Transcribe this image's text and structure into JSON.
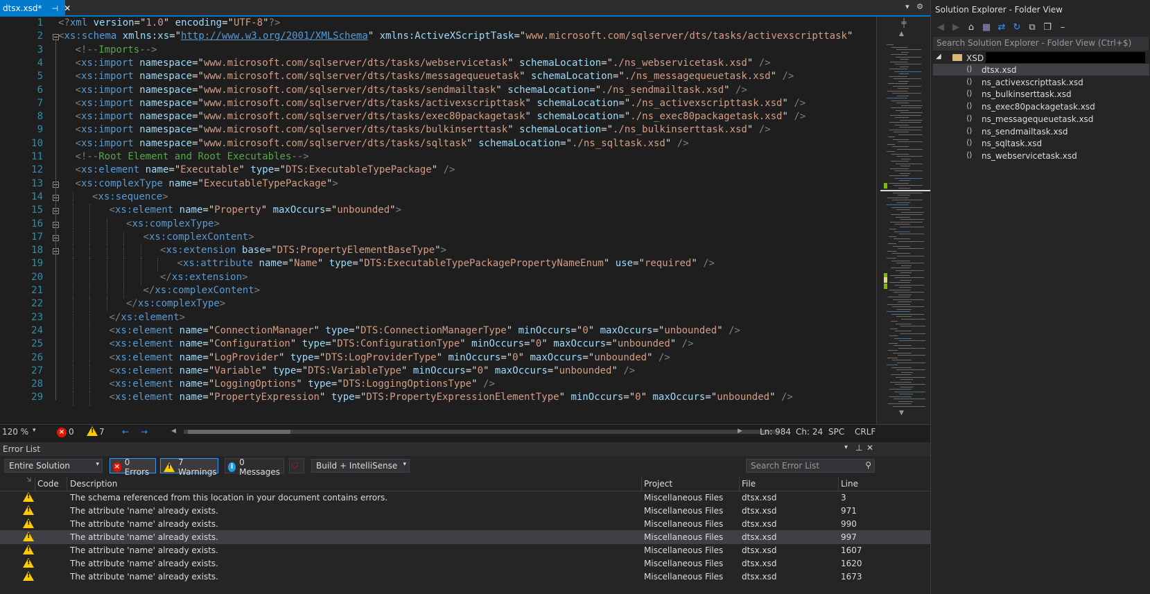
{
  "tab": {
    "title": "dtsx.xsd*",
    "pin": "⊣",
    "close": "✕"
  },
  "tab_tools": {
    "dropdown": "▾",
    "settings": "⚙"
  },
  "editor": {
    "lines": [
      {
        "n": "1",
        "fold": false,
        "indent": 0,
        "html": "<span class='pu'>&lt;?</span><span class='tag'>xml</span> <span class='at'>version</span><span class='tx'>=\"</span><span class='av'>1.0</span><span class='tx'>\"</span> <span class='at'>encoding</span><span class='tx'>=\"</span><span class='av'>UTF-8</span><span class='tx'>\"</span><span class='pu'>?&gt;</span>"
      },
      {
        "n": "2",
        "fold": true,
        "indent": 0,
        "html": "<span class='pu'>&lt;</span><span class='tag'>xs:schema</span> <span class='at'>xmlns:xs</span><span class='tx'>=\"</span><span class='av' style='color:#569cd6;text-decoration:underline'>http://www.w3.org/2001/XMLSchema</span><span class='tx'>\"</span> <span class='at'>xmlns:ActiveXScriptTask</span><span class='tx'>=\"</span><span class='av'>www.microsoft.com/sqlserver/dts/tasks/activexscripttask</span><span class='tx'>\"</span>"
      },
      {
        "n": "3",
        "fold": false,
        "indent": 1,
        "html": "<span class='pu'>&lt;!--</span><span class='cm'>Imports</span><span class='pu'>--&gt;</span>"
      },
      {
        "n": "4",
        "fold": false,
        "indent": 1,
        "html": "<span class='pu'>&lt;</span><span class='tag'>xs:import</span> <span class='at'>namespace</span><span class='tx'>=\"</span><span class='av'>www.microsoft.com/sqlserver/dts/tasks/webservicetask</span><span class='tx'>\"</span> <span class='at'>schemaLocation</span><span class='tx'>=\"</span><span class='av'>./ns_webservicetask.xsd</span><span class='tx'>\"</span> <span class='pu'>/&gt;</span>"
      },
      {
        "n": "5",
        "fold": false,
        "indent": 1,
        "html": "<span class='pu'>&lt;</span><span class='tag'>xs:import</span> <span class='at'>namespace</span><span class='tx'>=\"</span><span class='av'>www.microsoft.com/sqlserver/dts/tasks/messagequeuetask</span><span class='tx'>\"</span> <span class='at'>schemaLocation</span><span class='tx'>=\"</span><span class='av'>./ns_messagequeuetask.xsd</span><span class='tx'>\"</span> <span class='pu'>/&gt;</span>"
      },
      {
        "n": "6",
        "fold": false,
        "indent": 1,
        "html": "<span class='pu'>&lt;</span><span class='tag'>xs:import</span> <span class='at'>namespace</span><span class='tx'>=\"</span><span class='av'>www.microsoft.com/sqlserver/dts/tasks/sendmailtask</span><span class='tx'>\"</span> <span class='at'>schemaLocation</span><span class='tx'>=\"</span><span class='av'>./ns_sendmailtask.xsd</span><span class='tx'>\"</span> <span class='pu'>/&gt;</span>"
      },
      {
        "n": "7",
        "fold": false,
        "indent": 1,
        "html": "<span class='pu'>&lt;</span><span class='tag'>xs:import</span> <span class='at'>namespace</span><span class='tx'>=\"</span><span class='av'>www.microsoft.com/sqlserver/dts/tasks/activexscripttask</span><span class='tx'>\"</span> <span class='at'>schemaLocation</span><span class='tx'>=\"</span><span class='av'>./ns_activexscripttask.xsd</span><span class='tx'>\"</span> <span class='pu'>/&gt;</span>"
      },
      {
        "n": "8",
        "fold": false,
        "indent": 1,
        "html": "<span class='pu'>&lt;</span><span class='tag'>xs:import</span> <span class='at'>namespace</span><span class='tx'>=\"</span><span class='av'>www.microsoft.com/sqlserver/dts/tasks/exec80packagetask</span><span class='tx'>\"</span> <span class='at'>schemaLocation</span><span class='tx'>=\"</span><span class='av'>./ns_exec80packagetask.xsd</span><span class='tx'>\"</span> <span class='pu'>/&gt;</span>"
      },
      {
        "n": "9",
        "fold": false,
        "indent": 1,
        "html": "<span class='pu'>&lt;</span><span class='tag'>xs:import</span> <span class='at'>namespace</span><span class='tx'>=\"</span><span class='av'>www.microsoft.com/sqlserver/dts/tasks/bulkinserttask</span><span class='tx'>\"</span> <span class='at'>schemaLocation</span><span class='tx'>=\"</span><span class='av'>./ns_bulkinserttask.xsd</span><span class='tx'>\"</span> <span class='pu'>/&gt;</span>"
      },
      {
        "n": "10",
        "fold": false,
        "indent": 1,
        "html": "<span class='pu'>&lt;</span><span class='tag'>xs:import</span> <span class='at'>namespace</span><span class='tx'>=\"</span><span class='av'>www.microsoft.com/sqlserver/dts/tasks/sqltask</span><span class='tx'>\"</span> <span class='at'>schemaLocation</span><span class='tx'>=\"</span><span class='av'>./ns_sqltask.xsd</span><span class='tx'>\"</span> <span class='pu'>/&gt;</span>"
      },
      {
        "n": "11",
        "fold": false,
        "indent": 1,
        "html": "<span class='pu'>&lt;!--</span><span class='cm'>Root Element and Root Executables</span><span class='pu'>--&gt;</span>"
      },
      {
        "n": "12",
        "fold": false,
        "indent": 1,
        "html": "<span class='pu'>&lt;</span><span class='tag'>xs:element</span> <span class='at'>name</span><span class='tx'>=\"</span><span class='av'>Executable</span><span class='tx'>\"</span> <span class='at'>type</span><span class='tx'>=\"</span><span class='av'>DTS:ExecutableTypePackage</span><span class='tx'>\"</span> <span class='pu'>/&gt;</span>"
      },
      {
        "n": "13",
        "fold": true,
        "indent": 1,
        "html": "<span class='pu'>&lt;</span><span class='tag'>xs:complexType</span> <span class='at'>name</span><span class='tx'>=\"</span><span class='av'>ExecutableTypePackage</span><span class='tx'>\"</span><span class='pu'>&gt;</span>"
      },
      {
        "n": "14",
        "fold": true,
        "indent": 2,
        "html": "<span class='pu'>&lt;</span><span class='tag'>xs:sequence</span><span class='pu'>&gt;</span>"
      },
      {
        "n": "15",
        "fold": true,
        "indent": 3,
        "html": "<span class='pu'>&lt;</span><span class='tag'>xs:element</span> <span class='at'>name</span><span class='tx'>=\"</span><span class='av'>Property</span><span class='tx'>\"</span> <span class='at'>maxOccurs</span><span class='tx'>=\"</span><span class='av'>unbounded</span><span class='tx'>\"</span><span class='pu'>&gt;</span>"
      },
      {
        "n": "16",
        "fold": true,
        "indent": 4,
        "html": "<span class='pu'>&lt;</span><span class='tag'>xs:complexType</span><span class='pu'>&gt;</span>"
      },
      {
        "n": "17",
        "fold": true,
        "indent": 5,
        "html": "<span class='pu'>&lt;</span><span class='tag'>xs:complexContent</span><span class='pu'>&gt;</span>"
      },
      {
        "n": "18",
        "fold": true,
        "indent": 6,
        "html": "<span class='pu'>&lt;</span><span class='tag'>xs:extension</span> <span class='at'>base</span><span class='tx'>=\"</span><span class='av'>DTS:PropertyElementBaseType</span><span class='tx'>\"</span><span class='pu'>&gt;</span>"
      },
      {
        "n": "19",
        "fold": false,
        "indent": 7,
        "html": "<span class='pu'>&lt;</span><span class='tag'>xs:attribute</span> <span class='at'>name</span><span class='tx'>=\"</span><span class='av'>Name</span><span class='tx'>\"</span> <span class='at'>type</span><span class='tx'>=\"</span><span class='av'>DTS:ExecutableTypePackagePropertyNameEnum</span><span class='tx'>\"</span> <span class='at'>use</span><span class='tx'>=\"</span><span class='av'>required</span><span class='tx'>\"</span> <span class='pu'>/&gt;</span>"
      },
      {
        "n": "20",
        "fold": false,
        "indent": 6,
        "html": "<span class='pu'>&lt;/</span><span class='tag'>xs:extension</span><span class='pu'>&gt;</span>"
      },
      {
        "n": "21",
        "fold": false,
        "indent": 5,
        "html": "<span class='pu'>&lt;/</span><span class='tag'>xs:complexContent</span><span class='pu'>&gt;</span>"
      },
      {
        "n": "22",
        "fold": false,
        "indent": 4,
        "html": "<span class='pu'>&lt;/</span><span class='tag'>xs:complexType</span><span class='pu'>&gt;</span>"
      },
      {
        "n": "23",
        "fold": false,
        "indent": 3,
        "html": "<span class='pu'>&lt;/</span><span class='tag'>xs:element</span><span class='pu'>&gt;</span>"
      },
      {
        "n": "24",
        "fold": false,
        "indent": 3,
        "html": "<span class='pu'>&lt;</span><span class='tag'>xs:element</span> <span class='at'>name</span><span class='tx'>=\"</span><span class='av'>ConnectionManager</span><span class='tx'>\"</span> <span class='at'>type</span><span class='tx'>=\"</span><span class='av'>DTS:ConnectionManagerType</span><span class='tx'>\"</span> <span class='at'>minOccurs</span><span class='tx'>=\"</span><span class='av'>0</span><span class='tx'>\"</span> <span class='at'>maxOccurs</span><span class='tx'>=\"</span><span class='av'>unbounded</span><span class='tx'>\"</span> <span class='pu'>/&gt;</span>"
      },
      {
        "n": "25",
        "fold": false,
        "indent": 3,
        "html": "<span class='pu'>&lt;</span><span class='tag'>xs:element</span> <span class='at'>name</span><span class='tx'>=\"</span><span class='av'>Configuration</span><span class='tx'>\"</span> <span class='at'>type</span><span class='tx'>=\"</span><span class='av'>DTS:ConfigurationType</span><span class='tx'>\"</span> <span class='at'>minOccurs</span><span class='tx'>=\"</span><span class='av'>0</span><span class='tx'>\"</span> <span class='at'>maxOccurs</span><span class='tx'>=\"</span><span class='av'>unbounded</span><span class='tx'>\"</span> <span class='pu'>/&gt;</span>"
      },
      {
        "n": "26",
        "fold": false,
        "indent": 3,
        "html": "<span class='pu'>&lt;</span><span class='tag'>xs:element</span> <span class='at'>name</span><span class='tx'>=\"</span><span class='av'>LogProvider</span><span class='tx'>\"</span> <span class='at'>type</span><span class='tx'>=\"</span><span class='av'>DTS:LogProviderType</span><span class='tx'>\"</span> <span class='at'>minOccurs</span><span class='tx'>=\"</span><span class='av'>0</span><span class='tx'>\"</span> <span class='at'>maxOccurs</span><span class='tx'>=\"</span><span class='av'>unbounded</span><span class='tx'>\"</span> <span class='pu'>/&gt;</span>"
      },
      {
        "n": "27",
        "fold": false,
        "indent": 3,
        "html": "<span class='pu'>&lt;</span><span class='tag'>xs:element</span> <span class='at'>name</span><span class='tx'>=\"</span><span class='av'>Variable</span><span class='tx'>\"</span> <span class='at'>type</span><span class='tx'>=\"</span><span class='av'>DTS:VariableType</span><span class='tx'>\"</span> <span class='at'>minOccurs</span><span class='tx'>=\"</span><span class='av'>0</span><span class='tx'>\"</span> <span class='at'>maxOccurs</span><span class='tx'>=\"</span><span class='av'>unbounded</span><span class='tx'>\"</span> <span class='pu'>/&gt;</span>"
      },
      {
        "n": "28",
        "fold": false,
        "indent": 3,
        "html": "<span class='pu'>&lt;</span><span class='tag'>xs:element</span> <span class='at'>name</span><span class='tx'>=\"</span><span class='av'>LoggingOptions</span><span class='tx'>\"</span> <span class='at'>type</span><span class='tx'>=\"</span><span class='av'>DTS:LoggingOptionsType</span><span class='tx'>\"</span> <span class='pu'>/&gt;</span>"
      },
      {
        "n": "29",
        "fold": false,
        "indent": 3,
        "html": "<span class='pu'>&lt;</span><span class='tag'>xs:element</span> <span class='at'>name</span><span class='tx'>=\"</span><span class='av'>PropertyExpression</span><span class='tx'>\"</span> <span class='at'>type</span><span class='tx'>=\"</span><span class='av'>DTS:PropertyExpressionElementType</span><span class='tx'>\"</span> <span class='at'>minOccurs</span><span class='tx'>=\"</span><span class='av'>0</span><span class='tx'>\"</span> <span class='at'>maxOccurs</span><span class='tx'>=\"</span><span class='av'>unbounded</span><span class='tx'>\"</span> <span class='pu'>/&gt;</span>"
      }
    ]
  },
  "status": {
    "zoom": "120 %",
    "errors": "0",
    "warnings": "7",
    "ln": "Ln: 984",
    "ch": "Ch: 24",
    "spc": "SPC",
    "crlf": "CRLF"
  },
  "error_list": {
    "title": "Error List",
    "scope": "Entire Solution",
    "errors_btn": "0 Errors",
    "warnings_btn": "7 Warnings",
    "messages_btn": "0 Messages",
    "build_filter": "Build + IntelliSense",
    "search_placeholder": "Search Error List",
    "columns": {
      "code": "Code",
      "description": "Description",
      "project": "Project",
      "file": "File",
      "line": "Line"
    },
    "rows": [
      {
        "description": "The schema referenced from this location in your document contains errors.",
        "project": "Miscellaneous Files",
        "file": "dtsx.xsd",
        "line": "3"
      },
      {
        "description": "The attribute 'name' already exists.",
        "project": "Miscellaneous Files",
        "file": "dtsx.xsd",
        "line": "971"
      },
      {
        "description": "The attribute 'name' already exists.",
        "project": "Miscellaneous Files",
        "file": "dtsx.xsd",
        "line": "990"
      },
      {
        "description": "The attribute 'name' already exists.",
        "project": "Miscellaneous Files",
        "file": "dtsx.xsd",
        "line": "997"
      },
      {
        "description": "The attribute 'name' already exists.",
        "project": "Miscellaneous Files",
        "file": "dtsx.xsd",
        "line": "1607"
      },
      {
        "description": "The attribute 'name' already exists.",
        "project": "Miscellaneous Files",
        "file": "dtsx.xsd",
        "line": "1620"
      },
      {
        "description": "The attribute 'name' already exists.",
        "project": "Miscellaneous Files",
        "file": "dtsx.xsd",
        "line": "1673"
      }
    ]
  },
  "solution_explorer": {
    "title": "Solution Explorer - Folder View",
    "search_placeholder": "Search Solution Explorer - Folder View (Ctrl+$)",
    "folder": "XSD",
    "files": [
      "dtsx.xsd",
      "ns_activexscripttask.xsd",
      "ns_bulkinserttask.xsd",
      "ns_exec80packagetask.xsd",
      "ns_messagequeuetask.xsd",
      "ns_sendmailtask.xsd",
      "ns_sqltask.xsd",
      "ns_webservicetask.xsd"
    ]
  },
  "colors": {
    "accent": "#007acc",
    "tag": "#569cd6",
    "attr": "#9cdcfe",
    "value": "#d69d85",
    "comment": "#57a64a",
    "warning": "#ffcc00",
    "error": "#e51400"
  }
}
